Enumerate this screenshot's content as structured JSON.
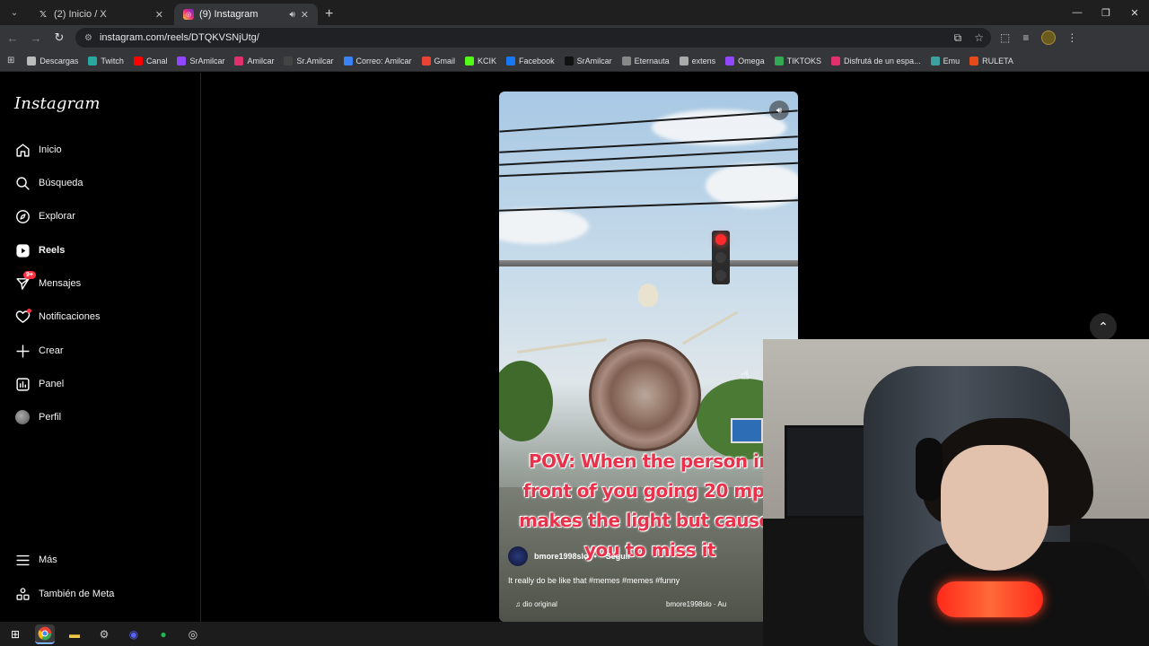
{
  "browser": {
    "tabs": [
      {
        "title": "(2) Inicio / X",
        "favicon": "x-icon",
        "active": false
      },
      {
        "title": "(9) Instagram",
        "favicon": "instagram-icon",
        "active": true,
        "audio": true
      }
    ],
    "url": "instagram.com/reels/DTQKVSNjUtg/",
    "bookmarks": [
      {
        "label": "Descargas",
        "icon": "download-icon",
        "color": "#bbbbbb"
      },
      {
        "label": "Twitch",
        "icon": "twitch-icon",
        "color": "#2aa8a0"
      },
      {
        "label": "Canal",
        "icon": "youtube-icon",
        "color": "#ff0000"
      },
      {
        "label": "SrAmilcar",
        "icon": "twitch-icon",
        "color": "#9146ff"
      },
      {
        "label": "Amilcar",
        "icon": "instagram-icon",
        "color": "#e1306c"
      },
      {
        "label": "Sr.Amilcar",
        "icon": "x-icon",
        "color": "#444444"
      },
      {
        "label": "Correo: Amilcar",
        "icon": "mail-icon",
        "color": "#3b82f6"
      },
      {
        "label": "Gmail",
        "icon": "gmail-icon",
        "color": "#ea4335"
      },
      {
        "label": "KCIK",
        "icon": "kick-icon",
        "color": "#53fc18"
      },
      {
        "label": "Facebook",
        "icon": "facebook-icon",
        "color": "#1877f2"
      },
      {
        "label": "SrAmilcar",
        "icon": "tiktok-icon",
        "color": "#111111"
      },
      {
        "label": "Eternauta",
        "icon": "doc-icon",
        "color": "#888888"
      },
      {
        "label": "extens",
        "icon": "puzzle-icon",
        "color": "#aaaaaa"
      },
      {
        "label": "Omega",
        "icon": "twitch-icon",
        "color": "#9146ff"
      },
      {
        "label": "TIKTOKS",
        "icon": "drive-icon",
        "color": "#34a853"
      },
      {
        "label": "Disfrutá de un espa...",
        "icon": "app-icon",
        "color": "#e1306c"
      },
      {
        "label": "Emu",
        "icon": "emu-icon",
        "color": "#3aa0a0"
      },
      {
        "label": "RULETA",
        "icon": "grid-icon",
        "color": "#e64a19"
      }
    ]
  },
  "sidebar": {
    "logo": "Instagram",
    "items": [
      {
        "label": "Inicio",
        "icon": "home-icon"
      },
      {
        "label": "Búsqueda",
        "icon": "search-icon"
      },
      {
        "label": "Explorar",
        "icon": "compass-icon"
      },
      {
        "label": "Reels",
        "icon": "reels-icon",
        "active": true
      },
      {
        "label": "Mensajes",
        "icon": "messenger-icon",
        "badge": "9+"
      },
      {
        "label": "Notificaciones",
        "icon": "heart-icon",
        "dot": true
      },
      {
        "label": "Crear",
        "icon": "plus-icon"
      },
      {
        "label": "Panel",
        "icon": "chart-icon"
      },
      {
        "label": "Perfil",
        "icon": "avatar-icon"
      }
    ],
    "bottom": [
      {
        "label": "Más",
        "icon": "menu-icon"
      },
      {
        "label": "También de Meta",
        "icon": "meta-icon"
      }
    ]
  },
  "reel": {
    "overlay_text": "POV: When the person in front of you going 20 mph makes the light but causes you to miss it",
    "username": "bmore1998slo",
    "separator": "•",
    "follow": "Seguir",
    "description": "It really do be like that #memes #memes #funny",
    "audio": "dio original",
    "audio_credit": "bmore1998slo · Au"
  },
  "colors": {
    "accent_red": "#ff3040",
    "caption_red": "#e8314a",
    "ig_bg": "#000000"
  }
}
